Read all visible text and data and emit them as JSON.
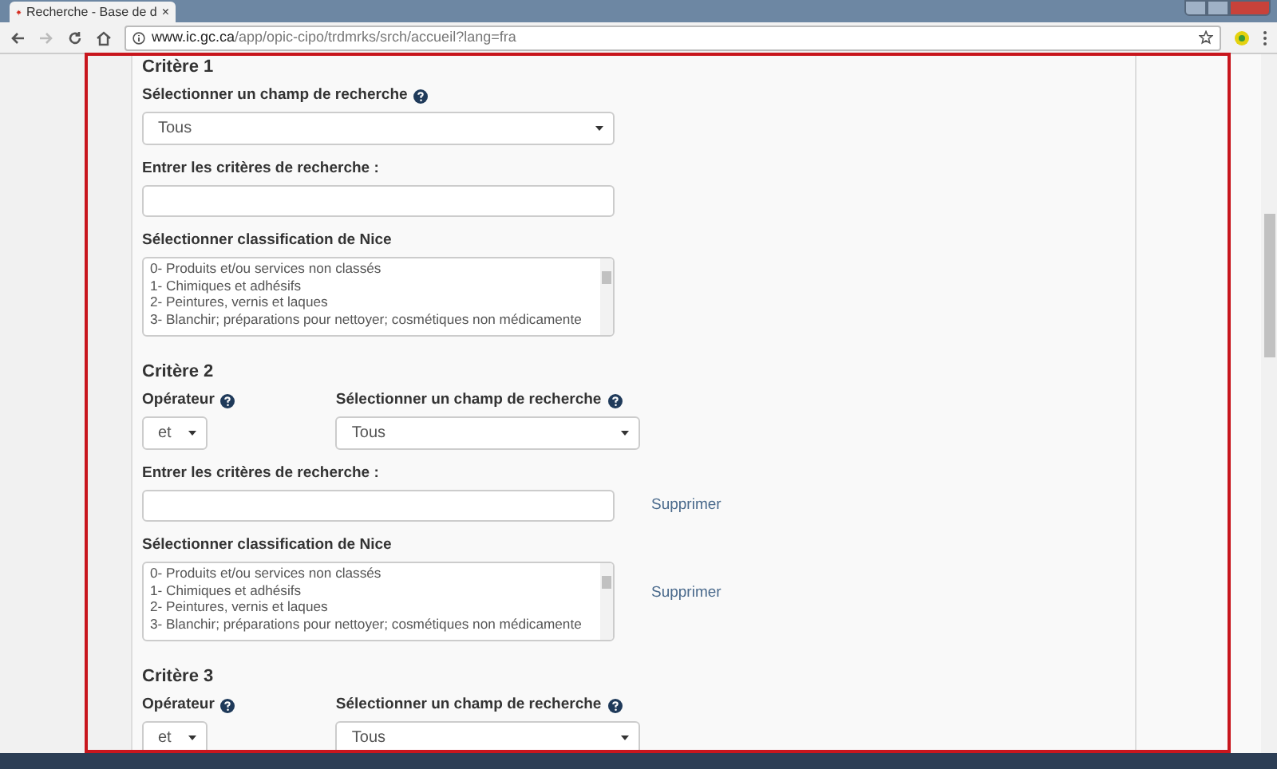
{
  "browser": {
    "tab_title": "Recherche - Base de d",
    "tab_close": "×",
    "forward_disabled": true,
    "url_domain": "www.ic.gc.ca",
    "url_path": "/app/opic-cipo/trdmrks/srch/accueil?lang=fra"
  },
  "criteria": [
    {
      "title": "Critère 1",
      "field": {
        "label": "Sélectionner un champ de recherche",
        "value": "Tous"
      },
      "terms": {
        "label": "Entrer les critères de recherche :"
      },
      "nice": {
        "label": "Sélectionner classification de Nice",
        "items": [
          "0- Produits et/ou services non classés",
          "1- Chimiques et adhésifs",
          "2- Peintures, vernis et laques",
          "3- Blanchir; préparations pour nettoyer; cosmétiques non médicamente"
        ]
      }
    },
    {
      "title": "Critère 2",
      "operator": {
        "label": "Opérateur",
        "value": "et"
      },
      "field": {
        "label": "Sélectionner un champ de recherche",
        "value": "Tous"
      },
      "terms": {
        "label": "Entrer les critères de recherche :",
        "remove": "Supprimer"
      },
      "nice": {
        "label": "Sélectionner classification de Nice",
        "items": [
          "0- Produits et/ou services non classés",
          "1- Chimiques et adhésifs",
          "2- Peintures, vernis et laques",
          "3- Blanchir; préparations pour nettoyer; cosmétiques non médicamente"
        ],
        "remove": "Supprimer"
      }
    },
    {
      "title": "Critère 3",
      "operator": {
        "label": "Opérateur",
        "value": "et"
      },
      "field": {
        "label": "Sélectionner un champ de recherche",
        "value": "Tous"
      }
    }
  ]
}
